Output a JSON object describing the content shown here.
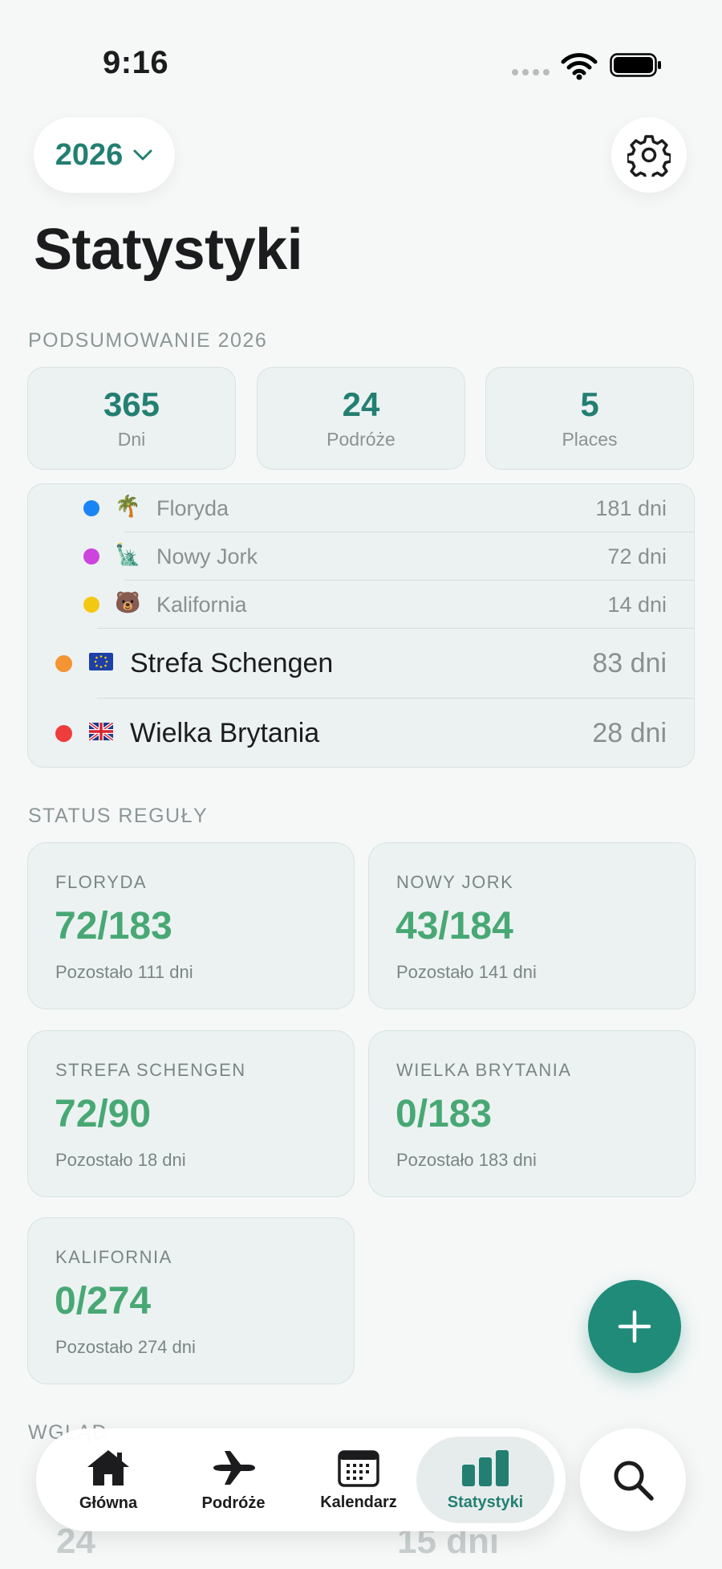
{
  "status_bar": {
    "time": "9:16"
  },
  "header": {
    "year": "2026",
    "title": "Statystyki"
  },
  "summary": {
    "label": "PODSUMOWANIE 2026",
    "boxes": [
      {
        "value": "365",
        "label": "Dni"
      },
      {
        "value": "24",
        "label": "Podróże"
      },
      {
        "value": "5",
        "label": "Places"
      }
    ]
  },
  "regions": [
    {
      "name": "Floryda",
      "days": "181 dni",
      "emoji": "🌴",
      "color": "#1a84f4"
    },
    {
      "name": "Nowy Jork",
      "days": "72 dni",
      "emoji": "🗽",
      "color": "#cc44dd"
    },
    {
      "name": "Kalifornia",
      "days": "14 dni",
      "emoji": "🐻",
      "color": "#f4c812"
    },
    {
      "name": "Strefa Schengen",
      "days": "83 dni",
      "emoji": "eu-flag",
      "color": "#f59432"
    },
    {
      "name": "Wielka Brytania",
      "days": "28 dni",
      "emoji": "uk-flag",
      "color": "#ef3d3d"
    }
  ],
  "rules": {
    "label": "STATUS REGUŁY",
    "cards": [
      {
        "title": "FLORYDA",
        "value": "72/183",
        "remaining": "Pozostało 111 dni"
      },
      {
        "title": "NOWY JORK",
        "value": "43/184",
        "remaining": "Pozostało 141 dni"
      },
      {
        "title": "STREFA SCHENGEN",
        "value": "72/90",
        "remaining": "Pozostało 18 dni"
      },
      {
        "title": "WIELKA BRYTANIA",
        "value": "0/183",
        "remaining": "Pozostało 183 dni"
      },
      {
        "title": "KALIFORNIA",
        "value": "0/274",
        "remaining": "Pozostało 274 dni"
      }
    ]
  },
  "insights": {
    "label": "WGLĄD",
    "peek_left": "24",
    "peek_right": "15 dni"
  },
  "tabs": [
    {
      "label": "Główna",
      "icon": "house-icon"
    },
    {
      "label": "Podróże",
      "icon": "airplane-icon"
    },
    {
      "label": "Kalendarz",
      "icon": "calendar-icon"
    },
    {
      "label": "Statystyki",
      "icon": "bar-chart-icon",
      "active": true
    }
  ],
  "colors": {
    "accent": "#237f72",
    "rule_value": "#48a874",
    "fab": "#1f8b78"
  }
}
